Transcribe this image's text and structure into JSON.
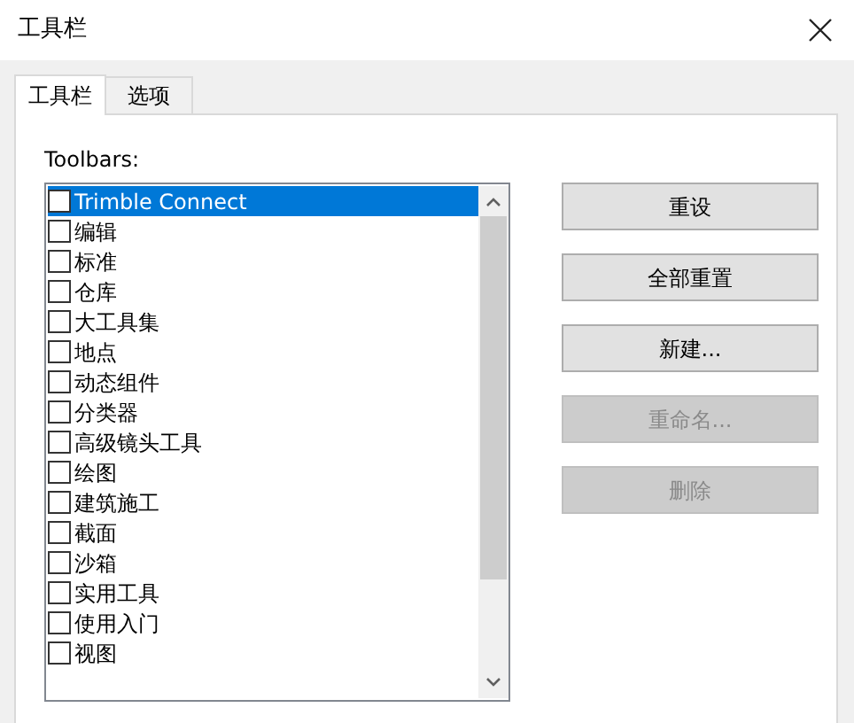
{
  "window": {
    "title": "工具栏"
  },
  "tabs": [
    {
      "label": "工具栏",
      "selected": true
    },
    {
      "label": "选项",
      "selected": false
    }
  ],
  "toolbars_label": "Toolbars:",
  "toolbars": [
    {
      "label": "Trimble Connect",
      "checked": false,
      "selected": true
    },
    {
      "label": "编辑",
      "checked": false,
      "selected": false
    },
    {
      "label": "标准",
      "checked": false,
      "selected": false
    },
    {
      "label": "仓库",
      "checked": false,
      "selected": false
    },
    {
      "label": "大工具集",
      "checked": false,
      "selected": false
    },
    {
      "label": "地点",
      "checked": false,
      "selected": false
    },
    {
      "label": "动态组件",
      "checked": false,
      "selected": false
    },
    {
      "label": "分类器",
      "checked": false,
      "selected": false
    },
    {
      "label": "高级镜头工具",
      "checked": false,
      "selected": false
    },
    {
      "label": "绘图",
      "checked": false,
      "selected": false
    },
    {
      "label": "建筑施工",
      "checked": false,
      "selected": false
    },
    {
      "label": "截面",
      "checked": false,
      "selected": false
    },
    {
      "label": "沙箱",
      "checked": false,
      "selected": false
    },
    {
      "label": "实用工具",
      "checked": false,
      "selected": false
    },
    {
      "label": "使用入门",
      "checked": false,
      "selected": false
    },
    {
      "label": "视图",
      "checked": false,
      "selected": false
    }
  ],
  "buttons": [
    {
      "label": "重设",
      "disabled": false
    },
    {
      "label": "全部重置",
      "disabled": false
    },
    {
      "label": "新建...",
      "disabled": false
    },
    {
      "label": "重命名...",
      "disabled": true
    },
    {
      "label": "删除",
      "disabled": true
    }
  ]
}
